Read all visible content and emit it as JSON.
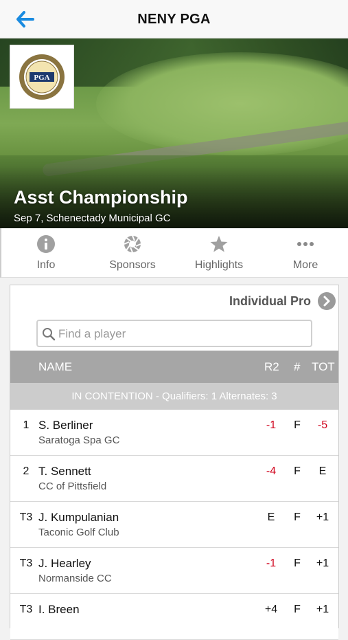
{
  "header": {
    "title": "NENY PGA",
    "back_icon": "back-arrow-icon"
  },
  "hero": {
    "logo_text": "PGA",
    "event_name": "Asst Championship",
    "event_sub": "Sep 7, Schenectady Municipal GC"
  },
  "tabs": [
    {
      "label": "Info",
      "icon": "info-icon"
    },
    {
      "label": "Sponsors",
      "icon": "aperture-icon"
    },
    {
      "label": "Highlights",
      "icon": "star-icon"
    },
    {
      "label": "More",
      "icon": "more-dots-icon"
    }
  ],
  "leaderboard": {
    "division": "Individual Pro",
    "search_placeholder": "Find a player",
    "columns": {
      "name": "NAME",
      "round": "R2",
      "thru": "#",
      "total": "TOT"
    },
    "group_label": "IN CONTENTION - Qualifiers: 1  Alternates: 3",
    "rows": [
      {
        "pos": "1",
        "name": "S. Berliner",
        "club": "Saratoga Spa GC",
        "r2": "-1",
        "thru": "F",
        "tot": "-5",
        "r2_red": true,
        "tot_red": true
      },
      {
        "pos": "2",
        "name": "T. Sennett",
        "club": "CC of Pittsfield",
        "r2": "-4",
        "thru": "F",
        "tot": "E",
        "r2_red": true,
        "tot_red": false
      },
      {
        "pos": "T3",
        "name": "J. Kumpulanian",
        "club": "Taconic Golf Club",
        "r2": "E",
        "thru": "F",
        "tot": "+1",
        "r2_red": false,
        "tot_red": false
      },
      {
        "pos": "T3",
        "name": "J. Hearley",
        "club": "Normanside CC",
        "r2": "-1",
        "thru": "F",
        "tot": "+1",
        "r2_red": true,
        "tot_red": false
      },
      {
        "pos": "T3",
        "name": "I. Breen",
        "club": "",
        "r2": "+4",
        "thru": "F",
        "tot": "+1",
        "r2_red": false,
        "tot_red": false
      }
    ]
  },
  "colors": {
    "accent": "#1a8be0",
    "negative": "#d0021b",
    "header_gray": "#a6a6a6",
    "group_gray": "#cccccc"
  }
}
